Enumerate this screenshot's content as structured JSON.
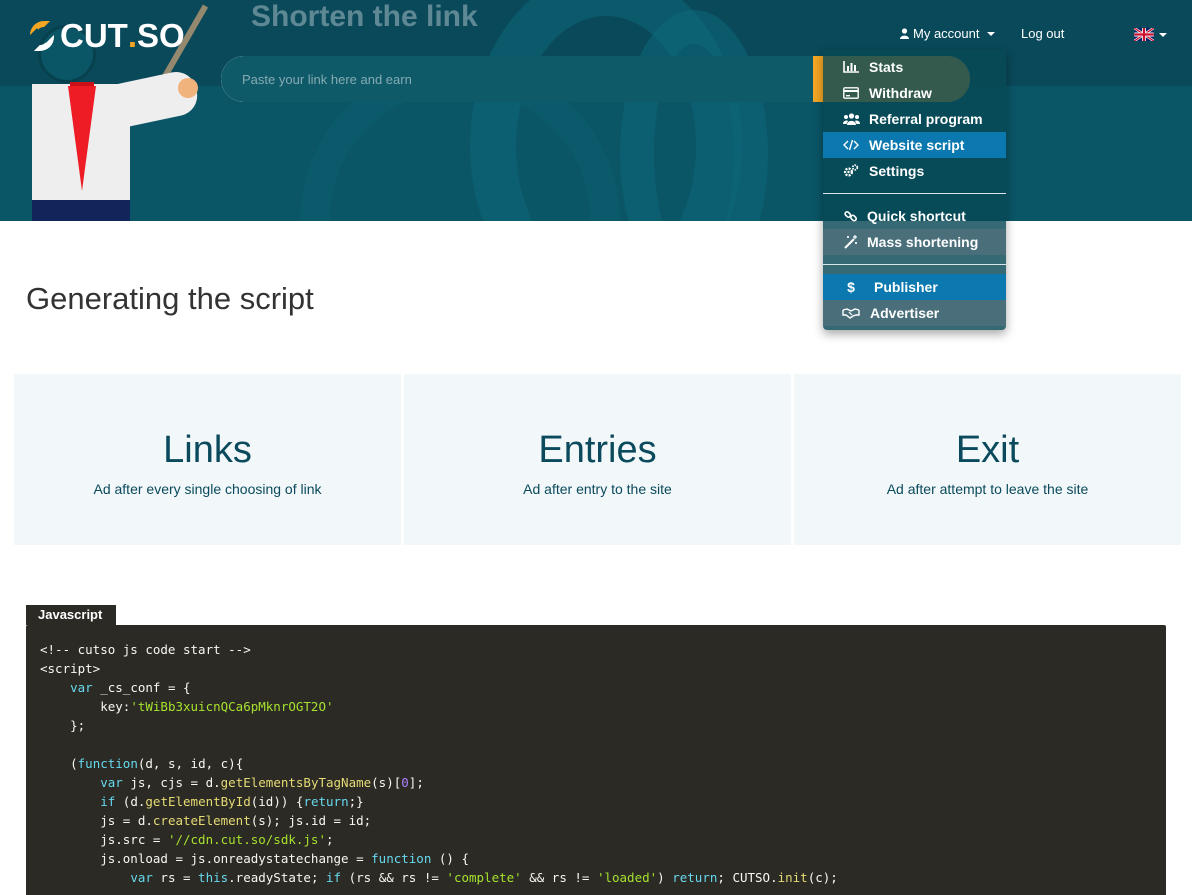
{
  "brand": {
    "logo_text": "CUT",
    "logo_dot": ".",
    "logo_suffix": "SO",
    "accent_color": "#f5a623",
    "primary_color": "#0a5566"
  },
  "hero": {
    "title": "Shorten the link",
    "input_placeholder": "Paste your link here and earn"
  },
  "nav": {
    "account_label": "My account",
    "logout_label": "Log out",
    "language_flag": "uk-flag-icon"
  },
  "dropdown": {
    "items": [
      {
        "label": "Stats",
        "icon": "bar-chart-icon"
      },
      {
        "label": "Withdraw",
        "icon": "credit-card-icon"
      },
      {
        "label": "Referral program",
        "icon": "users-icon"
      },
      {
        "label": "Website script",
        "icon": "code-icon",
        "active": true
      },
      {
        "label": "Settings",
        "icon": "cogs-icon"
      },
      {
        "label": "Quick shortcut",
        "icon": "link-icon"
      },
      {
        "label": "Mass shortening",
        "icon": "magic-wand-icon"
      },
      {
        "label": "Publisher",
        "icon": "dollar-icon",
        "active": true
      },
      {
        "label": "Advertiser",
        "icon": "handshake-icon"
      }
    ]
  },
  "page": {
    "title": "Generating the script"
  },
  "cards": [
    {
      "title": "Links",
      "subtitle": "Ad after every single choosing of link"
    },
    {
      "title": "Entries",
      "subtitle": "Ad after entry to the site"
    },
    {
      "title": "Exit",
      "subtitle": "Ad after attempt to leave the site"
    }
  ],
  "code": {
    "tab_label": "Javascript",
    "key": "tWiBb3xuicnQCa6pMknrOGT2O",
    "sdk_url": "//cdn.cut.so/sdk.js",
    "lines": [
      "<!-- cutso js code start -->",
      "<script>",
      "    var _cs_conf = {",
      "        key:'tWiBb3xuicnQCa6pMknrOGT2O'",
      "    };",
      "",
      "    (function(d, s, id, c){",
      "        var js, cjs = d.getElementsByTagName(s)[0];",
      "        if (d.getElementById(id)) {return;}",
      "        js = d.createElement(s); js.id = id;",
      "        js.src = '//cdn.cut.so/sdk.js';",
      "        js.onload = js.onreadystatechange = function () {",
      "            var rs = this.readyState; if (rs && rs != 'complete' && rs != 'loaded') return; CUTSO.init(c);"
    ]
  }
}
